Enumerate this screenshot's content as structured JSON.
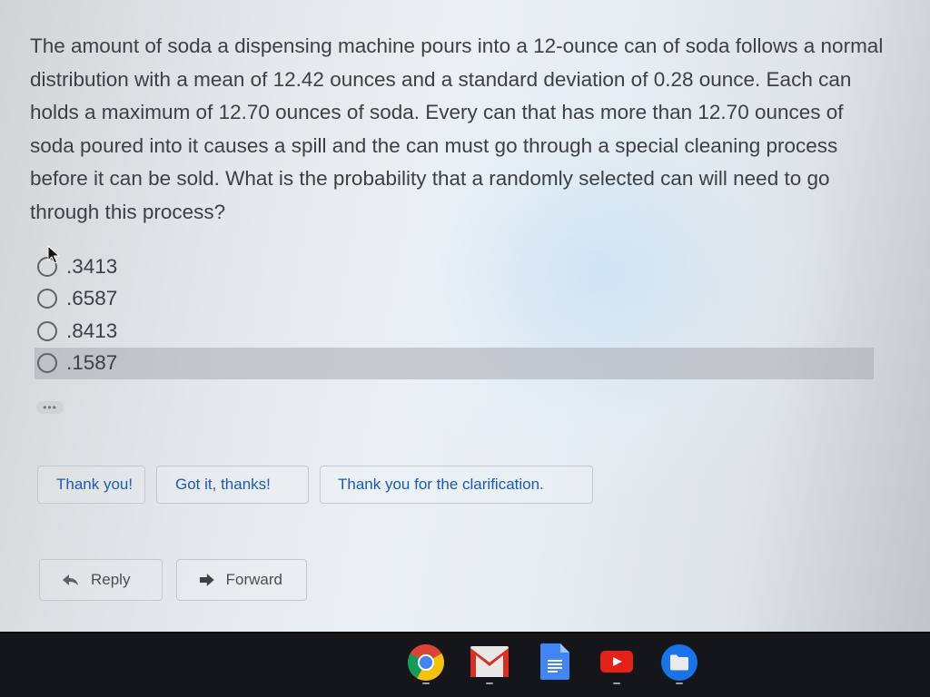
{
  "question": {
    "text": "The amount of soda a dispensing machine pours into a 12-ounce can of soda follows a normal distribution with a mean of 12.42 ounces and a standard deviation of 0.28 ounce. Each can holds a maximum of 12.70 ounces of soda. Every can that has more than 12.70 ounces of soda poured into it causes a spill and the can must go through a special cleaning process before it can be sold. What is the probability that a randomly selected can will need to go through this process?"
  },
  "options": [
    {
      "label": ".3413",
      "selected": false
    },
    {
      "label": ".6587",
      "selected": false
    },
    {
      "label": ".8413",
      "selected": false
    },
    {
      "label": ".1587",
      "selected": false,
      "hovered": true
    }
  ],
  "more_label": "•••",
  "smart_replies": [
    "Thank you!",
    "Got it, thanks!",
    "Thank you for the clarification."
  ],
  "actions": {
    "reply_label": "Reply",
    "forward_label": "Forward"
  },
  "shelf": {
    "apps": [
      {
        "name": "Chrome",
        "icon": "chrome-icon",
        "running": true
      },
      {
        "name": "Gmail",
        "icon": "gmail-icon",
        "running": true
      },
      {
        "name": "Docs",
        "icon": "docs-icon",
        "running": false
      },
      {
        "name": "YouTube",
        "icon": "youtube-icon",
        "running": true
      },
      {
        "name": "Files",
        "icon": "files-icon",
        "running": true
      }
    ]
  },
  "colors": {
    "link_blue": "#1a5bb5",
    "text": "#3c3f44",
    "shelf": "#14161a"
  }
}
